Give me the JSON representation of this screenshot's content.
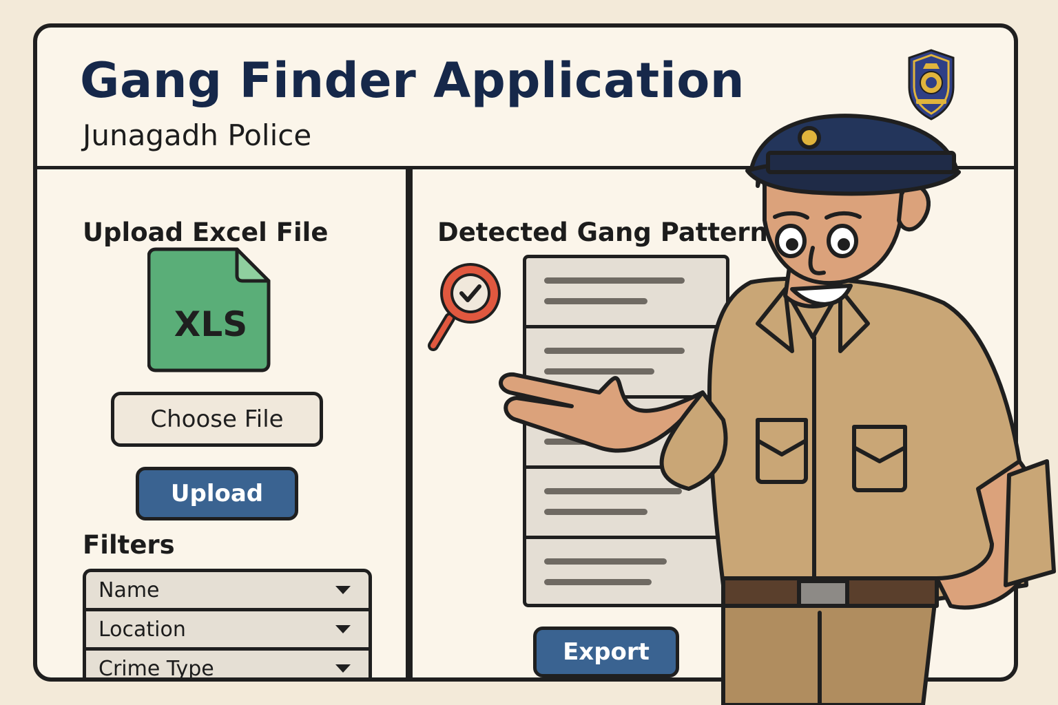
{
  "app": {
    "title": "Gang Finder Application",
    "subtitle": "Junagadh Police"
  },
  "upload": {
    "heading": "Upload Excel File",
    "file_icon_text": "XLS",
    "choose_label": "Choose File",
    "upload_label": "Upload"
  },
  "filters": {
    "heading": "Filters",
    "items": [
      "Name",
      "Location",
      "Crime Type"
    ]
  },
  "patterns": {
    "heading": "Detected Gang Patterns",
    "item_count": 5,
    "export_label": "Export"
  },
  "colors": {
    "title": "#16284a",
    "accent_button": "#3a6391",
    "excel_green": "#5aae78",
    "magnifier_red": "#e0583f",
    "background": "#f3ead9",
    "panel": "#fbf5ea"
  },
  "icons": {
    "badge": "police-badge-icon",
    "file": "xls-file-icon",
    "search": "magnifier-check-icon",
    "dropdown": "chevron-down-icon"
  }
}
